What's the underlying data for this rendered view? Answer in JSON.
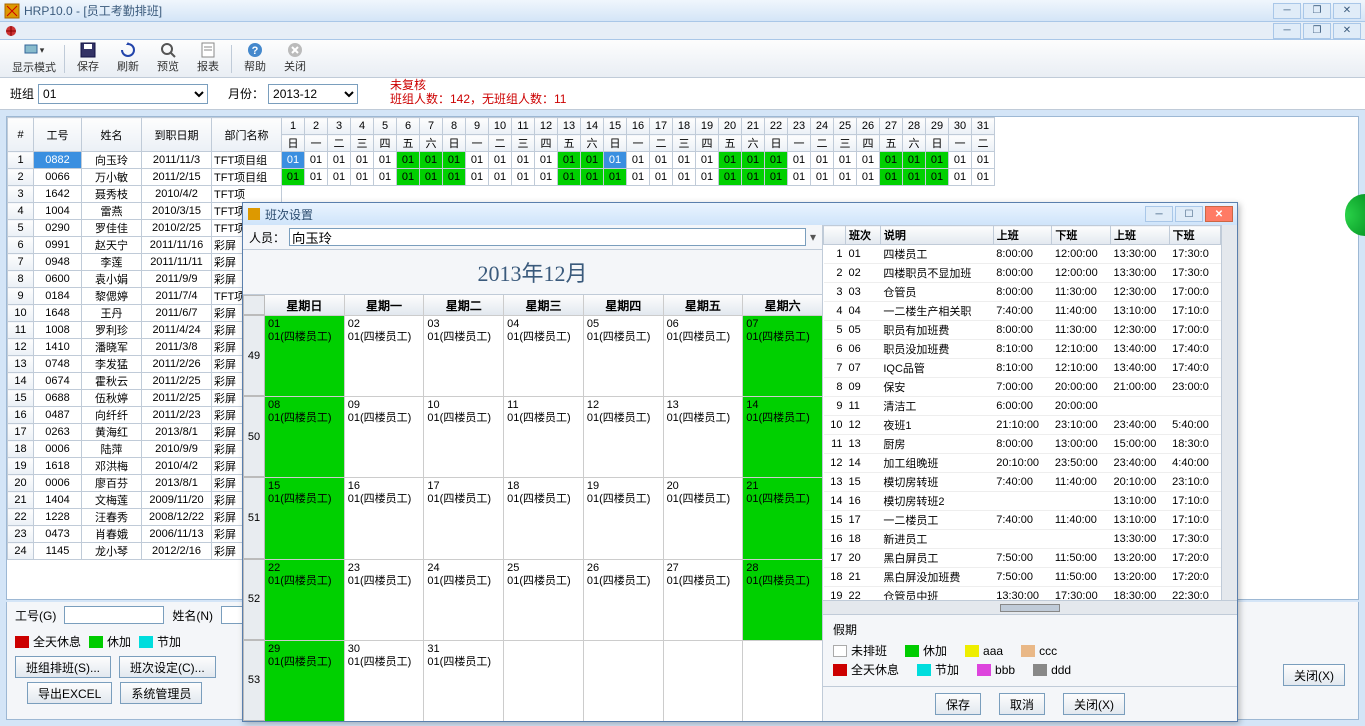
{
  "app": {
    "title": "HRP10.0 - [员工考勤排班]"
  },
  "toolbar": {
    "display_mode": "显示模式",
    "save": "保存",
    "refresh": "刷新",
    "preview": "预览",
    "report": "报表",
    "help": "帮助",
    "close": "关闭"
  },
  "filter": {
    "group_label": "班组",
    "group_value": "01",
    "month_label": "月份：",
    "month_value": "2013-12",
    "red1": "未复核",
    "red2": "班组人数：142，无班组人数：11"
  },
  "grid": {
    "cols": [
      "#",
      "工号",
      "姓名",
      "到职日期",
      "部门名称"
    ],
    "days": [
      1,
      2,
      3,
      4,
      5,
      6,
      7,
      8,
      9,
      10,
      11,
      12,
      13,
      14,
      15,
      16,
      17,
      18,
      19,
      20,
      21,
      22,
      23,
      24,
      25,
      26,
      27,
      28,
      29,
      30,
      31
    ],
    "dow": [
      "日",
      "一",
      "二",
      "三",
      "四",
      "五",
      "六",
      "日",
      "一",
      "二",
      "三",
      "四",
      "五",
      "六",
      "日",
      "一",
      "二",
      "三",
      "四",
      "五",
      "六",
      "日",
      "一",
      "二",
      "三",
      "四",
      "五",
      "六",
      "日",
      "一",
      "二"
    ],
    "rows": [
      {
        "n": 1,
        "id": "0882",
        "name": "向玉玲",
        "date": "2011/11/3",
        "dept": "TFT项目组",
        "fill": true,
        "sel": true
      },
      {
        "n": 2,
        "id": "0066",
        "name": "万小敏",
        "date": "2011/2/15",
        "dept": "TFT项目组",
        "fill": true
      },
      {
        "n": 3,
        "id": "1642",
        "name": "聂秀枝",
        "date": "2010/4/2",
        "dept": "TFT项"
      },
      {
        "n": 4,
        "id": "1004",
        "name": "雷燕",
        "date": "2010/3/15",
        "dept": "TFT项"
      },
      {
        "n": 5,
        "id": "0290",
        "name": "罗佳佳",
        "date": "2010/2/25",
        "dept": "TFT项"
      },
      {
        "n": 6,
        "id": "0991",
        "name": "赵天宁",
        "date": "2011/11/16",
        "dept": "彩屏"
      },
      {
        "n": 7,
        "id": "0948",
        "name": "李莲",
        "date": "2011/11/11",
        "dept": "彩屏"
      },
      {
        "n": 8,
        "id": "0600",
        "name": "袁小娟",
        "date": "2011/9/9",
        "dept": "彩屏"
      },
      {
        "n": 9,
        "id": "0184",
        "name": "黎偲婷",
        "date": "2011/7/4",
        "dept": "TFT项"
      },
      {
        "n": 10,
        "id": "1648",
        "name": "王丹",
        "date": "2011/6/7",
        "dept": "彩屏"
      },
      {
        "n": 11,
        "id": "1008",
        "name": "罗利珍",
        "date": "2011/4/24",
        "dept": "彩屏"
      },
      {
        "n": 12,
        "id": "1410",
        "name": "潘晓军",
        "date": "2011/3/8",
        "dept": "彩屏"
      },
      {
        "n": 13,
        "id": "0748",
        "name": "李发猛",
        "date": "2011/2/26",
        "dept": "彩屏"
      },
      {
        "n": 14,
        "id": "0674",
        "name": "霍秋云",
        "date": "2011/2/25",
        "dept": "彩屏"
      },
      {
        "n": 15,
        "id": "0688",
        "name": "伍秋婷",
        "date": "2011/2/25",
        "dept": "彩屏"
      },
      {
        "n": 16,
        "id": "0487",
        "name": "向纤纤",
        "date": "2011/2/23",
        "dept": "彩屏"
      },
      {
        "n": 17,
        "id": "0263",
        "name": "黄海红",
        "date": "2013/8/1",
        "dept": "彩屏"
      },
      {
        "n": 18,
        "id": "0006",
        "name": "陆萍",
        "date": "2010/9/9",
        "dept": "彩屏"
      },
      {
        "n": 19,
        "id": "1618",
        "name": "邓洪梅",
        "date": "2010/4/2",
        "dept": "彩屏"
      },
      {
        "n": 20,
        "id": "0006",
        "name": "廖百芬",
        "date": "2013/8/1",
        "dept": "彩屏"
      },
      {
        "n": 21,
        "id": "1404",
        "name": "文梅莲",
        "date": "2009/11/20",
        "dept": "彩屏"
      },
      {
        "n": 22,
        "id": "1228",
        "name": "汪春秀",
        "date": "2008/12/22",
        "dept": "彩屏"
      },
      {
        "n": 23,
        "id": "0473",
        "name": "肖春娥",
        "date": "2006/11/13",
        "dept": "彩屏"
      },
      {
        "n": 24,
        "id": "1145",
        "name": "龙小琴",
        "date": "2012/2/16",
        "dept": "彩屏"
      }
    ]
  },
  "bottom": {
    "id_label": "工号(G)",
    "name_label": "姓名(N)",
    "lg_fullday": "全天休息",
    "lg_rest": "休加",
    "lg_jiejia": "节加",
    "btn_group_shift": "班组排班(S)...",
    "btn_shift_set": "班次设定(C)...",
    "btn_export": "导出EXCEL",
    "btn_admin": "系统管理员",
    "btn_close": "关闭(X)"
  },
  "dialog": {
    "title": "班次设置",
    "person_label": "人员：",
    "person_value": "向玉玲",
    "cal_title": "2013年12月",
    "weekdays": [
      "星期日",
      "星期一",
      "星期二",
      "星期三",
      "星期四",
      "星期五",
      "星期六"
    ],
    "weeknums": [
      "49",
      "50",
      "51",
      "52",
      "53"
    ],
    "cell_label": "01(四楼员工)",
    "cells": [
      {
        "d": "01",
        "g": true
      },
      {
        "d": "02"
      },
      {
        "d": "03"
      },
      {
        "d": "04"
      },
      {
        "d": "05"
      },
      {
        "d": "06"
      },
      {
        "d": "07",
        "g": true
      },
      {
        "d": "08",
        "g": true
      },
      {
        "d": "09"
      },
      {
        "d": "10"
      },
      {
        "d": "11"
      },
      {
        "d": "12"
      },
      {
        "d": "13"
      },
      {
        "d": "14",
        "g": true
      },
      {
        "d": "15",
        "g": true
      },
      {
        "d": "16"
      },
      {
        "d": "17"
      },
      {
        "d": "18"
      },
      {
        "d": "19"
      },
      {
        "d": "20"
      },
      {
        "d": "21",
        "g": true
      },
      {
        "d": "22",
        "g": true
      },
      {
        "d": "23"
      },
      {
        "d": "24"
      },
      {
        "d": "25"
      },
      {
        "d": "26"
      },
      {
        "d": "27"
      },
      {
        "d": "28",
        "g": true
      },
      {
        "d": "29",
        "g": true
      },
      {
        "d": "30"
      },
      {
        "d": "31"
      },
      {
        "d": ""
      },
      {
        "d": ""
      },
      {
        "d": ""
      },
      {
        "d": ""
      }
    ],
    "shift_cols": [
      "",
      "班次",
      "说明",
      "上班",
      "下班",
      "上班",
      "下班"
    ],
    "shifts": [
      {
        "n": 1,
        "c": "01",
        "d": "四楼员工",
        "t": [
          "8:00:00",
          "12:00:00",
          "13:30:00",
          "17:30:0"
        ]
      },
      {
        "n": 2,
        "c": "02",
        "d": "四楼职员不显加班",
        "t": [
          "8:00:00",
          "12:00:00",
          "13:30:00",
          "17:30:0"
        ]
      },
      {
        "n": 3,
        "c": "03",
        "d": "仓管员",
        "t": [
          "8:00:00",
          "11:30:00",
          "12:30:00",
          "17:00:0"
        ]
      },
      {
        "n": 4,
        "c": "04",
        "d": "一二楼生产相关职",
        "t": [
          "7:40:00",
          "11:40:00",
          "13:10:00",
          "17:10:0"
        ]
      },
      {
        "n": 5,
        "c": "05",
        "d": "职员有加班费",
        "t": [
          "8:00:00",
          "11:30:00",
          "12:30:00",
          "17:00:0"
        ]
      },
      {
        "n": 6,
        "c": "06",
        "d": "职员没加班费",
        "t": [
          "8:10:00",
          "12:10:00",
          "13:40:00",
          "17:40:0"
        ]
      },
      {
        "n": 7,
        "c": "07",
        "d": "IQC品管",
        "t": [
          "8:10:00",
          "12:10:00",
          "13:40:00",
          "17:40:0"
        ]
      },
      {
        "n": 8,
        "c": "09",
        "d": "保安",
        "t": [
          "7:00:00",
          "20:00:00",
          "21:00:00",
          "23:00:0"
        ]
      },
      {
        "n": 9,
        "c": "11",
        "d": "清洁工",
        "t": [
          "6:00:00",
          "20:00:00",
          "",
          ""
        ]
      },
      {
        "n": 10,
        "c": "12",
        "d": "夜班1",
        "t": [
          "21:10:00",
          "23:10:00",
          "23:40:00",
          "5:40:00"
        ]
      },
      {
        "n": 11,
        "c": "13",
        "d": "厨房",
        "t": [
          "8:00:00",
          "13:00:00",
          "15:00:00",
          "18:30:0"
        ]
      },
      {
        "n": 12,
        "c": "14",
        "d": "加工组晚班",
        "t": [
          "20:10:00",
          "23:50:00",
          "23:40:00",
          "4:40:00"
        ]
      },
      {
        "n": 13,
        "c": "15",
        "d": "模切房转班",
        "t": [
          "7:40:00",
          "11:40:00",
          "20:10:00",
          "23:10:0"
        ]
      },
      {
        "n": 14,
        "c": "16",
        "d": "模切房转班2",
        "t": [
          "",
          "",
          "13:10:00",
          "17:10:0"
        ]
      },
      {
        "n": 15,
        "c": "17",
        "d": "一二楼员工",
        "t": [
          "7:40:00",
          "11:40:00",
          "13:10:00",
          "17:10:0"
        ]
      },
      {
        "n": 16,
        "c": "18",
        "d": "新进员工",
        "t": [
          "",
          "",
          "13:30:00",
          "17:30:0"
        ]
      },
      {
        "n": 17,
        "c": "20",
        "d": "黑白屏员工",
        "t": [
          "7:50:00",
          "11:50:00",
          "13:20:00",
          "17:20:0"
        ]
      },
      {
        "n": 18,
        "c": "21",
        "d": "黑白屏没加班费",
        "t": [
          "7:50:00",
          "11:50:00",
          "13:20:00",
          "17:20:0"
        ]
      },
      {
        "n": 19,
        "c": "22",
        "d": "仓管员中班",
        "t": [
          "13:30:00",
          "17:30:00",
          "18:30:00",
          "22:30:0"
        ]
      }
    ],
    "legend_title": "假期",
    "lg_unarranged": "未排班",
    "lg_rest": "休加",
    "lg_aaa": "aaa",
    "lg_ccc": "ccc",
    "lg_fullday": "全天休息",
    "lg_jiejia": "节加",
    "lg_bbb": "bbb",
    "lg_ddd": "ddd",
    "btn_save": "保存",
    "btn_cancel": "取消",
    "btn_close": "关闭(X)"
  }
}
